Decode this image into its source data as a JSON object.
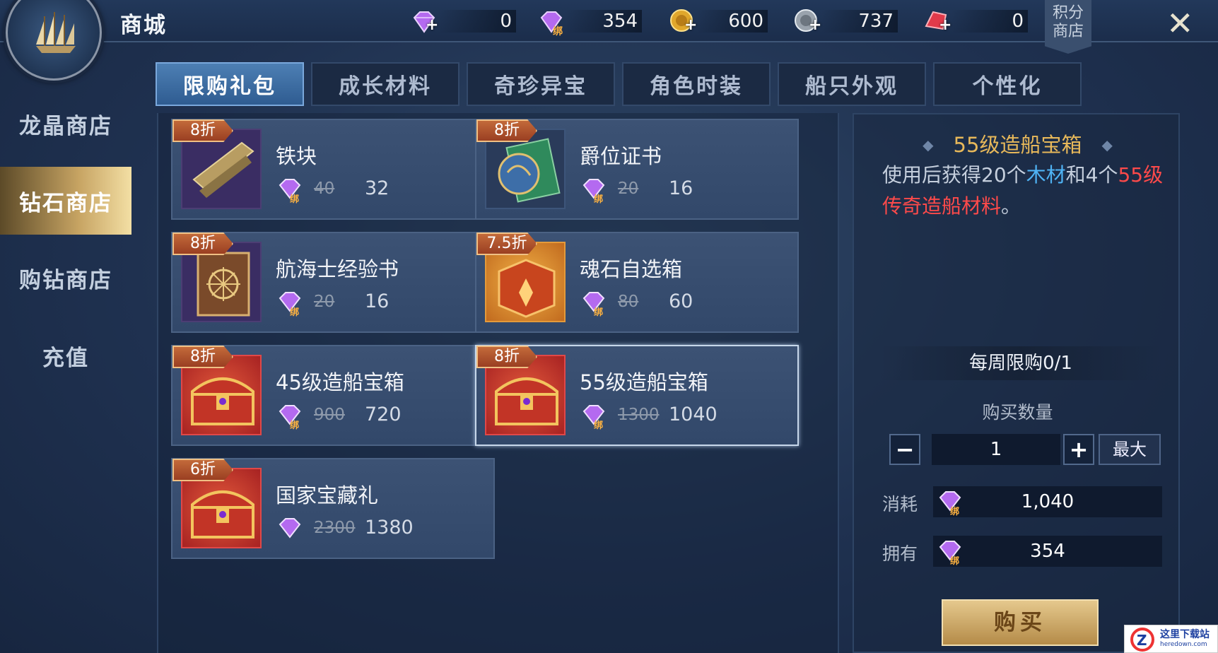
{
  "header": {
    "title": "商城",
    "jifen_label": "积分\n商店"
  },
  "currencies": [
    {
      "icon": "diamond-icon",
      "value": "0",
      "plus": true,
      "bound": false
    },
    {
      "icon": "bound-diamond-icon",
      "value": "354",
      "plus": false,
      "bound": true,
      "bound_mark": "绑"
    },
    {
      "icon": "gold-coin-icon",
      "value": "600",
      "plus": true
    },
    {
      "icon": "silver-coin-icon",
      "value": "737",
      "plus": true
    },
    {
      "icon": "red-crystal-icon",
      "value": "0",
      "plus": true
    }
  ],
  "sidebar": {
    "items": [
      {
        "label": "龙晶商店",
        "active": false
      },
      {
        "label": "钻石商店",
        "active": true
      },
      {
        "label": "购钻商店",
        "active": false
      },
      {
        "label": "充值",
        "active": false
      }
    ]
  },
  "tabs": [
    {
      "label": "限购礼包",
      "active": true
    },
    {
      "label": "成长材料",
      "active": false
    },
    {
      "label": "奇珍异宝",
      "active": false
    },
    {
      "label": "角色时装",
      "active": false
    },
    {
      "label": "船只外观",
      "active": false
    },
    {
      "label": "个性化",
      "active": false
    }
  ],
  "items": [
    {
      "name": "铁块",
      "discount": "8折",
      "old_price": "40",
      "price": "32",
      "bound": true,
      "icon": "iron-ingot-icon"
    },
    {
      "name": "爵位证书",
      "discount": "8折",
      "old_price": "20",
      "price": "16",
      "bound": true,
      "icon": "globe-certificate-icon"
    },
    {
      "name": "航海士经验书",
      "discount": "8折",
      "old_price": "20",
      "price": "16",
      "bound": true,
      "icon": "experience-book-icon"
    },
    {
      "name": "魂石自选箱",
      "discount": "7.5折",
      "old_price": "80",
      "price": "60",
      "bound": true,
      "icon": "soulstone-box-icon"
    },
    {
      "name": "45级造船宝箱",
      "discount": "8折",
      "old_price": "900",
      "price": "720",
      "bound": true,
      "icon": "treasure-chest-icon"
    },
    {
      "name": "55级造船宝箱",
      "discount": "8折",
      "old_price": "1300",
      "price": "1040",
      "bound": true,
      "icon": "treasure-chest-icon",
      "selected": true
    },
    {
      "name": "国家宝藏礼",
      "discount": "6折",
      "old_price": "2300",
      "price": "1380",
      "bound": false,
      "icon": "treasure-chest-icon"
    }
  ],
  "detail": {
    "title": "55级造船宝箱",
    "desc_pre": "使用后获得20个",
    "desc_blue": "木材",
    "desc_mid": "和4个",
    "desc_red": "55级传奇造船材料",
    "desc_end": "。",
    "weekly": "每周限购0/1",
    "qty_label": "购买数量",
    "qty": "1",
    "minus": "−",
    "plus": "+",
    "max_label": "最大",
    "cost_label": "消耗",
    "cost": "1,040",
    "own_label": "拥有",
    "own": "354",
    "buy_label": "购买"
  },
  "bound_mark": "绑",
  "watermark": {
    "title": "这里下载站",
    "sub": "heredown.com"
  },
  "colors": {
    "accent_gold": "#e7b85a",
    "blue_text": "#4fb3f4",
    "red_text": "#ff4a4a",
    "tab_active": "#3a6ca3"
  }
}
